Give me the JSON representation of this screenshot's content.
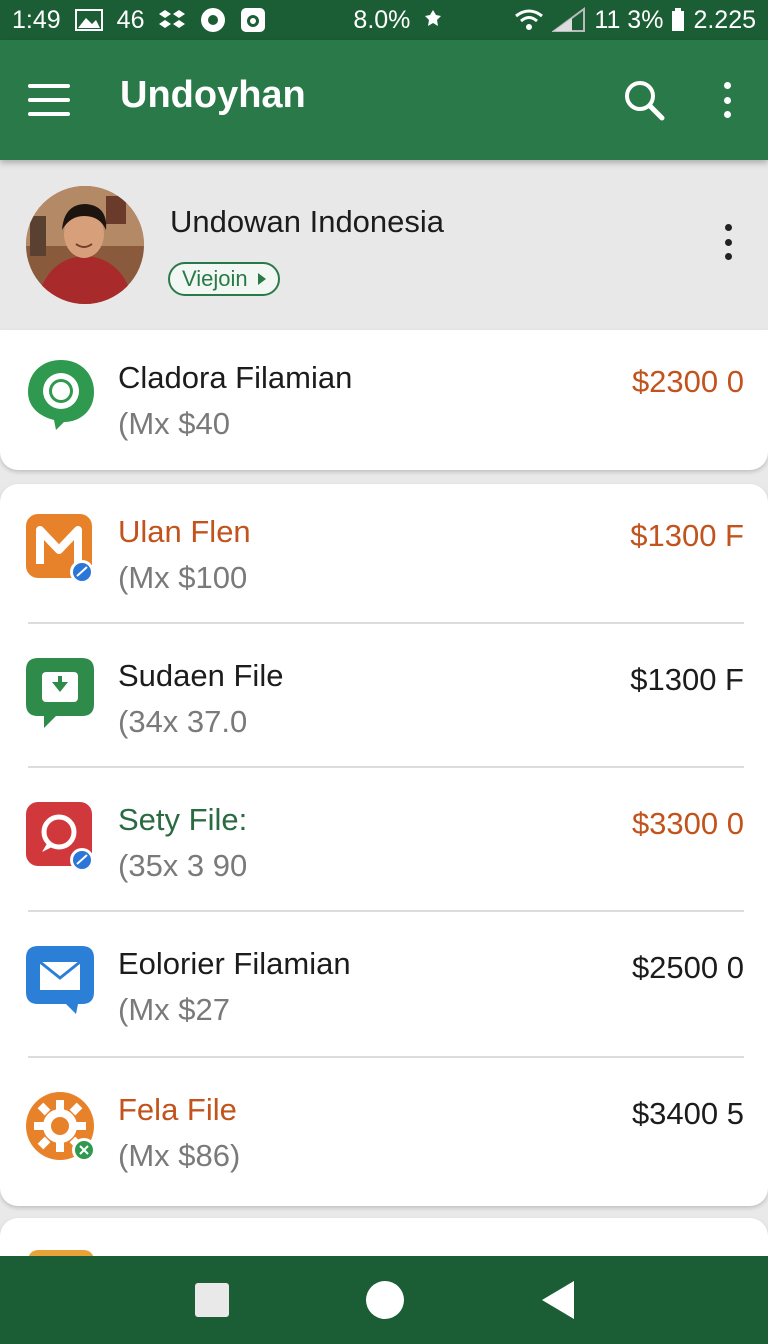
{
  "status_bar": {
    "time": "1:49",
    "notif_count": "46",
    "battery_pct": "8.0%",
    "signal_text": "11 3%",
    "speed": "2.225"
  },
  "app_bar": {
    "title": "Undoyhan",
    "menu_icon": "hamburger-menu-icon",
    "search_icon": "search-icon",
    "more_icon": "more-vert-icon"
  },
  "profile": {
    "name": "Undowan Indonesia",
    "view_label": "Viejoin"
  },
  "featured_item": {
    "name": "Cladora Filamian",
    "sub": "(Mx  $40",
    "price": "$2300 0",
    "icon": "chat-bubble-icon"
  },
  "items": [
    {
      "name": "Ulan Flen",
      "sub": "(Mx  $100",
      "price": "$1300 F",
      "icon": "m-app-icon",
      "name_color": "#c2531d",
      "price_color": "#c2531d"
    },
    {
      "name": "Sudaen File",
      "sub": "(34x  37.0",
      "price": "$1300 F",
      "icon": "download-chat-icon",
      "name_color": "#1c1c1c",
      "price_color": "#1c1c1c"
    },
    {
      "name": "Sety File:",
      "sub": "(35x  3 90",
      "price": "$3300 0",
      "icon": "red-chat-icon",
      "name_color": "#2b6b43",
      "price_color": "#c2531d"
    },
    {
      "name": "Eolorier Filamian",
      "sub": "(Mx  $27",
      "price": "$2500 0",
      "icon": "mail-icon",
      "name_color": "#1c1c1c",
      "price_color": "#1c1c1c"
    },
    {
      "name": "Fela File",
      "sub": "(Mx  $86)",
      "price": "$3400 5",
      "icon": "gear-icon",
      "name_color": "#c2531d",
      "price_color": "#1c1c1c"
    }
  ],
  "colors": {
    "primary": "#2a7a49",
    "status_bar": "#1b5e35",
    "accent_orange": "#c2531d"
  }
}
